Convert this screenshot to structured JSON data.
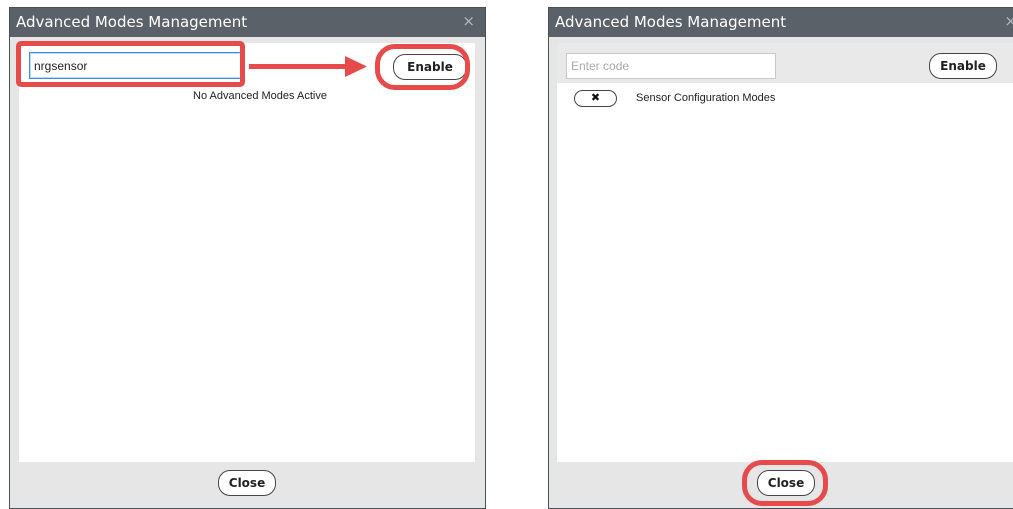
{
  "left_dialog": {
    "title": "Advanced Modes Management",
    "close_glyph": "×",
    "code_input_value": "nrgsensor",
    "enable_label": "Enable",
    "empty_message": "No Advanced Modes Active",
    "close_label": "Close"
  },
  "right_dialog": {
    "title": "Advanced Modes Management",
    "close_glyph": "×",
    "code_input_placeholder": "Enter code",
    "enable_label": "Enable",
    "modes": [
      {
        "remove_glyph": "✖",
        "label": "Sensor Configuration Modes"
      }
    ],
    "close_label": "Close"
  },
  "annotation": {
    "color": "#e64a4a",
    "arrow_icon": "right-arrow-icon"
  },
  "colors": {
    "titlebar": "#5b6168",
    "dialog_bg": "#e6e6e6",
    "content_bg": "#ffffff"
  }
}
